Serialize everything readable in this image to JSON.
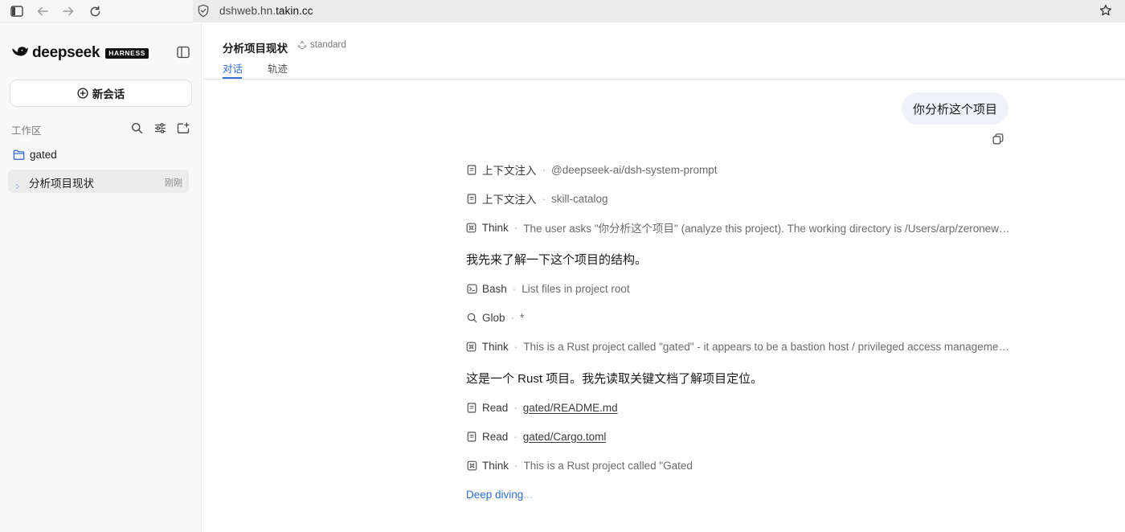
{
  "browser": {
    "url_prefix": "dshweb.hn.",
    "url_domain": "takin.cc"
  },
  "sidebar": {
    "logo_text": "deepseek",
    "logo_badge": "HARNESS",
    "new_chat_label": "新会话",
    "workspace_label": "工作区",
    "folder_name": "gated",
    "sessions": [
      {
        "title": "分析项目现状",
        "time": "刚刚"
      }
    ]
  },
  "header": {
    "title": "分析项目现状",
    "mode": "standard",
    "tabs": [
      {
        "label": "对话",
        "active": true
      },
      {
        "label": "轨迹",
        "active": false
      }
    ]
  },
  "conversation": {
    "user_message": "你分析这个项目",
    "steps": [
      {
        "icon": "document-icon",
        "kind": "上下文注入",
        "detail": "@deepseek-ai/dsh-system-prompt",
        "link": false
      },
      {
        "icon": "document-icon",
        "kind": "上下文注入",
        "detail": "skill-catalog",
        "link": false
      },
      {
        "icon": "think-icon",
        "kind": "Think",
        "detail": "The user asks \"你分析这个项目\" (analyze this project). The working directory is /Users/arp/zeronews/g...",
        "link": false
      },
      {
        "icon": "terminal-icon",
        "kind": "Bash",
        "detail": "List files in project root",
        "link": false
      },
      {
        "icon": "search-icon",
        "kind": "Glob",
        "detail": "*",
        "link": false
      },
      {
        "icon": "think-icon",
        "kind": "Think",
        "detail": "This is a Rust project called \"gated\" - it appears to be a bastion host / privileged access management ...",
        "link": false
      },
      {
        "icon": "document-icon",
        "kind": "Read",
        "detail": "gated/README.md",
        "link": true
      },
      {
        "icon": "document-icon",
        "kind": "Read",
        "detail": "gated/Cargo.toml",
        "link": true
      },
      {
        "icon": "think-icon",
        "kind": "Think",
        "detail": "This is a Rust project called \"Gated",
        "link": false
      }
    ],
    "prose": [
      "我先来了解一下这个项目的结构。",
      "这是一个 Rust 项目。我先读取关键文档了解项目定位。"
    ],
    "status_part1": "Deep diving",
    "status_part2": "..."
  },
  "colors": {
    "accent": "#2f6fd1",
    "bubble": "#eef1f7",
    "sidebar_bg": "#f9f9f9",
    "selected_item": "#ececec"
  }
}
